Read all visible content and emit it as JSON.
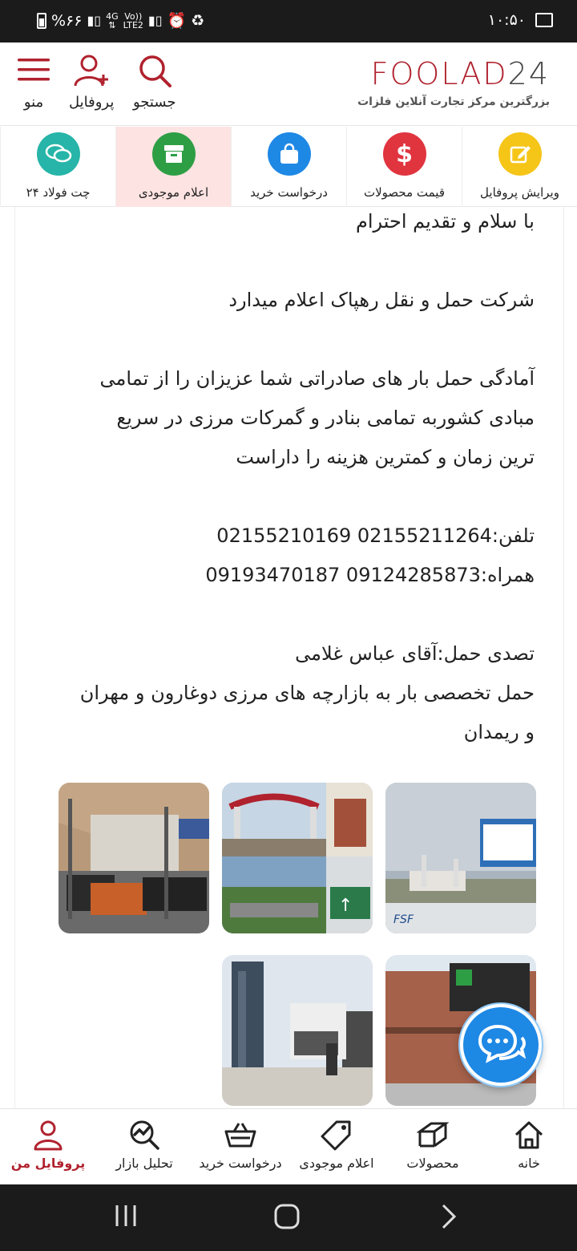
{
  "status_bar": {
    "time": "۱۰:۵۰",
    "battery": "%۶۶",
    "network_top": "4G",
    "network_volte": "Vo))",
    "network_lte": "LTE2"
  },
  "header": {
    "logo_text": "FOOLAD",
    "logo_num": "24",
    "tagline": "بزرگترین مرکز تجارت آنلاین فلزات",
    "search_label": "جستجو",
    "profile_label": "پروفایل",
    "menu_label": "منو"
  },
  "categories": [
    {
      "label": "ویرایش پروفایل",
      "icon": "edit-icon",
      "color": "#f5c518"
    },
    {
      "label": "قیمت محصولات",
      "icon": "dollar-icon",
      "color": "#e0343f"
    },
    {
      "label": "درخواست خرید",
      "icon": "shopping-bag-icon",
      "color": "#1e88e5"
    },
    {
      "label": "اعلام موجودی",
      "icon": "archive-box-icon",
      "color": "#2e9e45"
    },
    {
      "label": "چت فولاد ۲۴",
      "icon": "chat-bubbles-icon",
      "color": "#26b5a8"
    }
  ],
  "article": {
    "greeting": "با سلام و تقدیم احترام",
    "announce": "شرکت حمل و نقل رهپاک اعلام میدارد",
    "body1": "آمادگی حمل بار های صادراتی شما عزیزان را از تمامی",
    "body2": "مبادی کشوربه تمامی بنادر و گمرکات مرزی در سریع",
    "body3": "ترین زمان و کمترین هزینه را داراست",
    "phone": "تلفن:02155211264 02155210169",
    "mobile": "همراه:09124285873 09193470187",
    "manager": "تصدی حمل:آقای عباس غلامی",
    "special1": "حمل تخصصی بار به بازارچه های مرزی دوغارون و مهران",
    "special2": "و ریمدان"
  },
  "bottom_nav": [
    {
      "label": "خانه",
      "icon": "home-icon"
    },
    {
      "label": "محصولات",
      "icon": "products-icon"
    },
    {
      "label": "اعلام موجودی",
      "icon": "tag-icon"
    },
    {
      "label": "درخواست خرید",
      "icon": "basket-icon"
    },
    {
      "label": "تحلیل بازار",
      "icon": "analysis-icon"
    },
    {
      "label": "پروفایل من",
      "icon": "user-icon",
      "active": true
    }
  ],
  "colors": {
    "brand": "#b0222e",
    "active_tab_bg": "#fde3e2",
    "fab": "#1e88e5"
  }
}
